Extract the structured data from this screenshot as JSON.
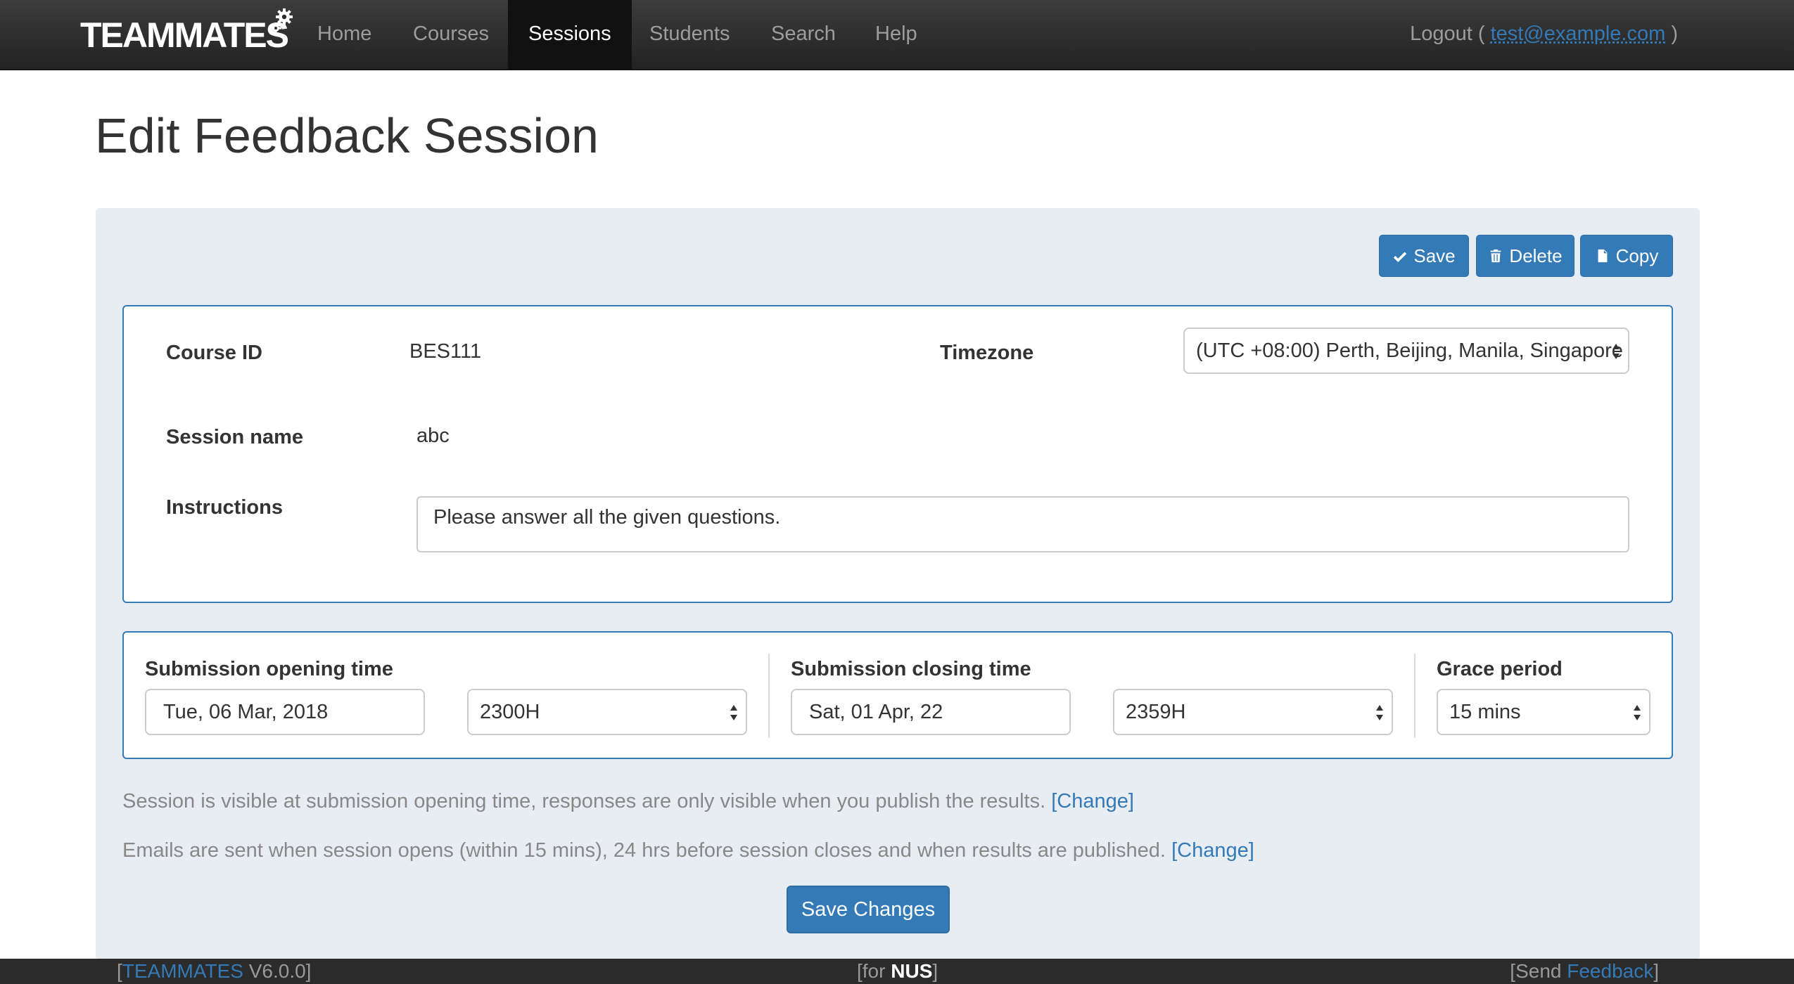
{
  "navbar": {
    "brand": "TEAMMATES",
    "items": [
      {
        "label": "Home"
      },
      {
        "label": "Courses"
      },
      {
        "label": "Sessions"
      },
      {
        "label": "Students"
      },
      {
        "label": "Search"
      },
      {
        "label": "Help"
      }
    ],
    "active_item": "Sessions",
    "logout_prefix": "Logout (",
    "user_email": "test@example.com",
    "logout_suffix": ")"
  },
  "page_title": "Edit Feedback Session",
  "actions": {
    "save": "Save",
    "delete": "Delete",
    "copy": "Copy"
  },
  "details": {
    "course_id_label": "Course ID",
    "course_id": "BES111",
    "timezone_label": "Timezone",
    "timezone_value": "(UTC +08:00) Perth, Beijing, Manila, Singapore",
    "session_name_label": "Session name",
    "session_name": "abc",
    "instructions_label": "Instructions",
    "instructions": "Please answer all the given questions."
  },
  "timing": {
    "opening_label": "Submission opening time",
    "opening_date": "Tue, 06 Mar, 2018",
    "opening_time": "2300H",
    "closing_label": "Submission closing time",
    "closing_date": "Sat, 01 Apr, 22",
    "closing_time": "2359H",
    "grace_label": "Grace period",
    "grace_value": "15 mins"
  },
  "info": {
    "visibility_text": "Session is visible at submission opening time, responses are only visible when you publish the results.",
    "emails_text": "Emails are sent when session opens (within 15 mins), 24 hrs before session closes and when results are published.",
    "change_link": "[Change]"
  },
  "save_changes": "Save Changes",
  "footer": {
    "left_open": "[",
    "app_name": "TEAMMATES",
    "version": "V6.0.0]",
    "center_prefix": "[for",
    "institution": "NUS",
    "center_suffix": "]",
    "right_prefix": "[Send",
    "feedback_link": "Feedback",
    "right_suffix": "]"
  },
  "colors": {
    "primary": "#337ab7",
    "navbar_bg": "#222222",
    "panel_bg": "#e8edf3"
  }
}
